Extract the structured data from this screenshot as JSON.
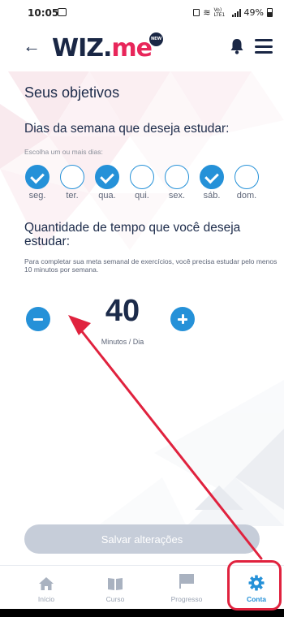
{
  "status_bar": {
    "time": "10:05",
    "network": "Vo) LTE1",
    "battery": "49%"
  },
  "header": {
    "logo_part1": "WIZ",
    "logo_dot": ".",
    "logo_part2": "me",
    "logo_badge": "NEW",
    "back_icon": "arrow-left-icon",
    "bell_icon": "bell-icon",
    "menu_icon": "hamburger-menu-icon"
  },
  "page": {
    "title": "Seus objetivos",
    "days_heading": "Dias da semana que deseja estudar:",
    "days_hint": "Escolha um ou mais dias:",
    "days": [
      {
        "label": "seg.",
        "checked": true
      },
      {
        "label": "ter.",
        "checked": false
      },
      {
        "label": "qua.",
        "checked": true
      },
      {
        "label": "qui.",
        "checked": false
      },
      {
        "label": "sex.",
        "checked": false
      },
      {
        "label": "sáb.",
        "checked": true
      },
      {
        "label": "dom.",
        "checked": false
      }
    ],
    "time_heading": "Quantidade de tempo que você deseja estudar:",
    "time_hint": "Para completar sua meta semanal de exercícios, você precisa estudar pelo menos 10 minutos por semana.",
    "minutes_value": "40",
    "minutes_unit": "Minutos / Dia",
    "save_label": "Salvar alterações"
  },
  "bottom_nav": {
    "items": [
      {
        "label": "Início",
        "icon": "home-icon",
        "active": false
      },
      {
        "label": "Curso",
        "icon": "book-icon",
        "active": false
      },
      {
        "label": "Progresso",
        "icon": "flag-icon",
        "active": false
      },
      {
        "label": "Conta",
        "icon": "gear-icon",
        "active": true
      }
    ]
  },
  "colors": {
    "accent": "#2591d8",
    "brand_pink": "#e8265a",
    "navy": "#1a2745",
    "annotation_red": "#e0223e",
    "disabled_button": "#c6cdd9"
  }
}
